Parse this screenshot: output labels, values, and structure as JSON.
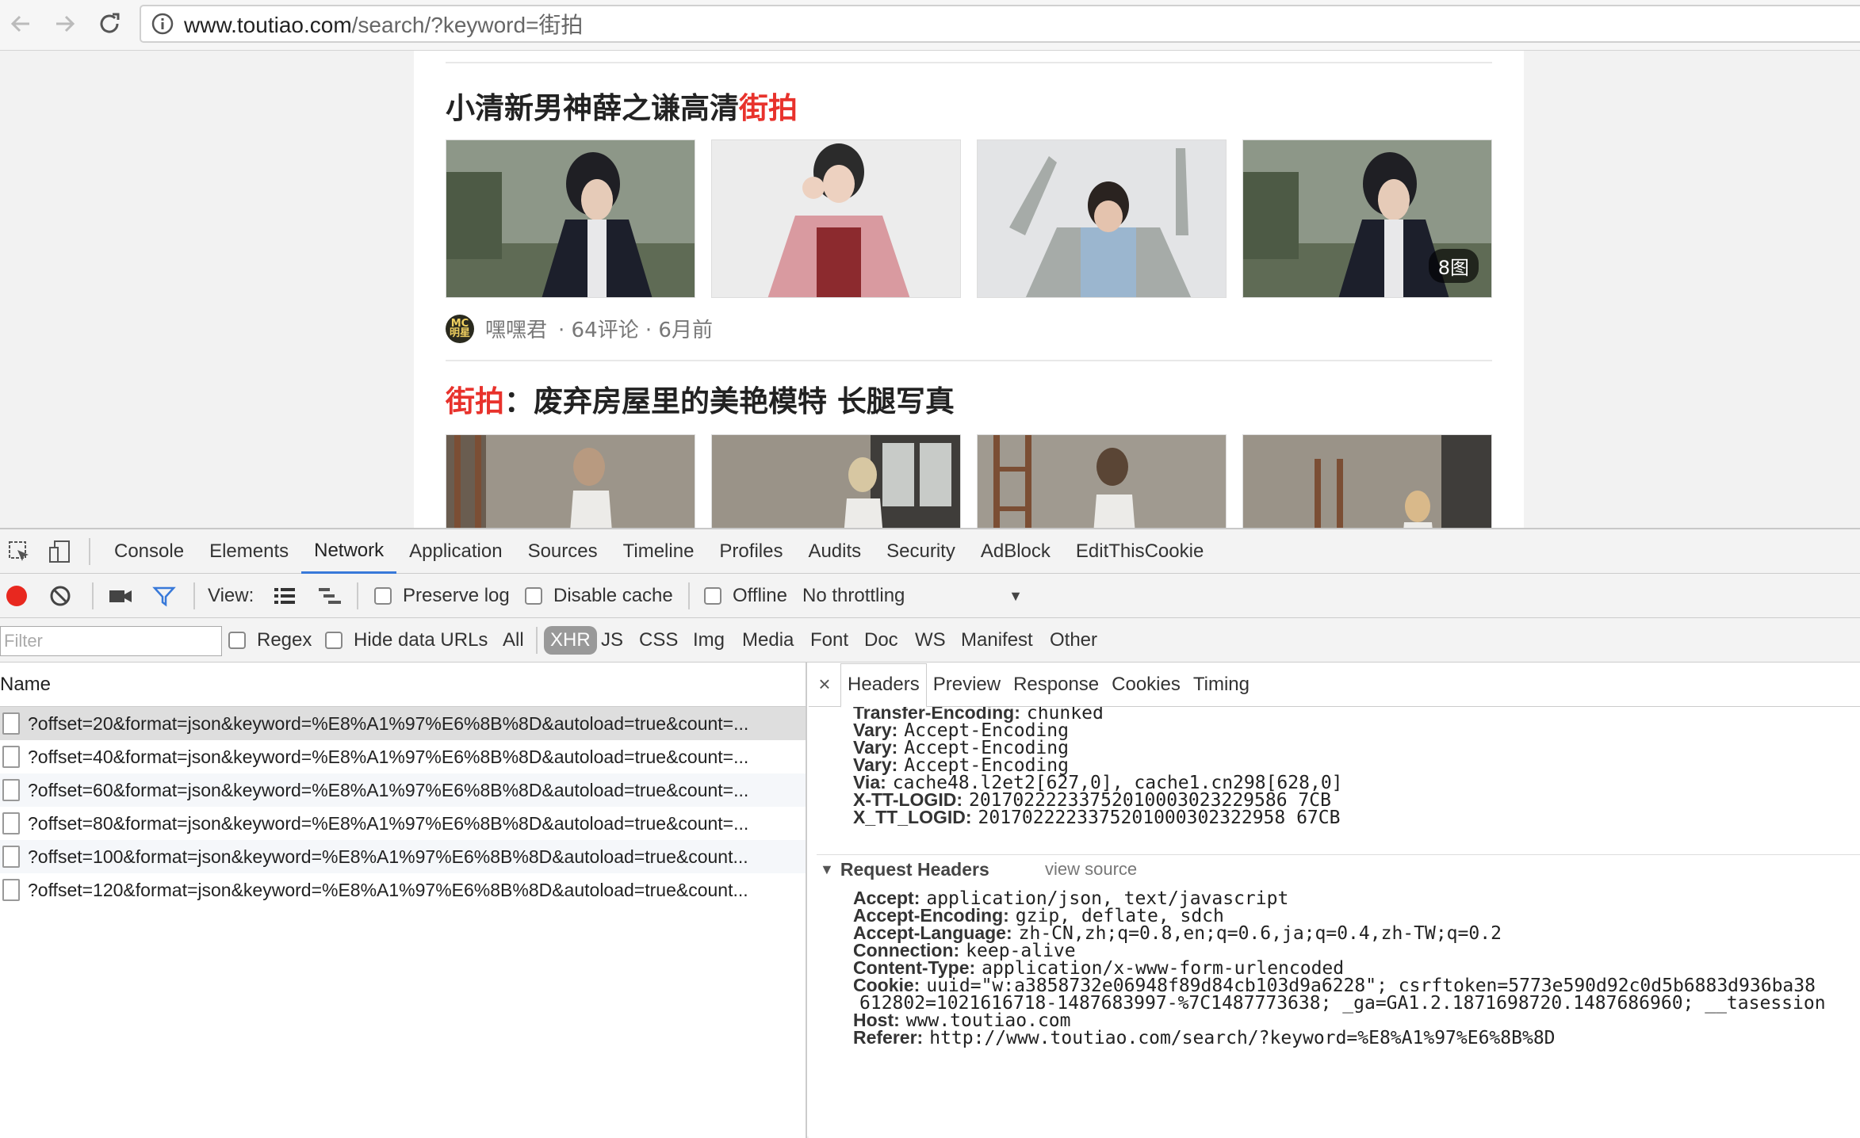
{
  "browser": {
    "url_host": "www.toutiao.com",
    "url_path": "/search/?keyword=街拍"
  },
  "page": {
    "article1": {
      "title_main": "小清新男神薛之谦高清",
      "title_highlight": "街拍",
      "image_count": "8图",
      "author": "嘿嘿君",
      "meta": "· 64评论 · 6月前",
      "avatar_text": "MC 明星"
    },
    "article2": {
      "title_highlight": "街拍",
      "title_main": "：废弃房屋里的美艳模特 长腿写真"
    }
  },
  "devtools": {
    "tabs": [
      "Console",
      "Elements",
      "Network",
      "Application",
      "Sources",
      "Timeline",
      "Profiles",
      "Audits",
      "Security",
      "AdBlock",
      "EditThisCookie"
    ],
    "active_tab": "Network",
    "toolbar": {
      "view_label": "View:",
      "preserve_log": "Preserve log",
      "disable_cache": "Disable cache",
      "offline": "Offline",
      "throttling": "No throttling"
    },
    "filter": {
      "placeholder": "Filter",
      "regex": "Regex",
      "hide_data_urls": "Hide data URLs",
      "types": [
        "All",
        "XHR",
        "JS",
        "CSS",
        "Img",
        "Media",
        "Font",
        "Doc",
        "WS",
        "Manifest",
        "Other"
      ],
      "active_type": "XHR"
    },
    "requests": {
      "column_name": "Name",
      "rows": [
        "?offset=20&format=json&keyword=%E8%A1%97%E6%8B%8D&autoload=true&count=...",
        "?offset=40&format=json&keyword=%E8%A1%97%E6%8B%8D&autoload=true&count=...",
        "?offset=60&format=json&keyword=%E8%A1%97%E6%8B%8D&autoload=true&count=...",
        "?offset=80&format=json&keyword=%E8%A1%97%E6%8B%8D&autoload=true&count=...",
        "?offset=100&format=json&keyword=%E8%A1%97%E6%8B%8D&autoload=true&count...",
        "?offset=120&format=json&keyword=%E8%A1%97%E6%8B%8D&autoload=true&count..."
      ]
    },
    "details": {
      "close": "×",
      "tabs": [
        "Headers",
        "Preview",
        "Response",
        "Cookies",
        "Timing"
      ],
      "active_tab": "Headers",
      "response_headers": [
        {
          "k": "Transfer-Encoding:",
          "v": "chunked"
        },
        {
          "k": "Vary:",
          "v": "Accept-Encoding"
        },
        {
          "k": "Vary:",
          "v": "Accept-Encoding"
        },
        {
          "k": "Vary:",
          "v": "Accept-Encoding"
        },
        {
          "k": "Via:",
          "v": "cache48.l2et2[627,0], cache1.cn298[628,0]"
        },
        {
          "k": "X-TT-LOGID:",
          "v": "20170222233752010003023229586 7CB"
        },
        {
          "k": "X_TT_LOGID:",
          "v": "2017022223375201000302322958 67CB"
        }
      ],
      "request_headers_title": "Request Headers",
      "view_source": "view source",
      "request_headers": [
        {
          "k": "Accept:",
          "v": "application/json, text/javascript"
        },
        {
          "k": "Accept-Encoding:",
          "v": "gzip, deflate, sdch"
        },
        {
          "k": "Accept-Language:",
          "v": "zh-CN,zh;q=0.8,en;q=0.6,ja;q=0.4,zh-TW;q=0.2"
        },
        {
          "k": "Connection:",
          "v": "keep-alive"
        },
        {
          "k": "Content-Type:",
          "v": "application/x-www-form-urlencoded"
        },
        {
          "k": "Cookie:",
          "v": "uuid=\"w:a3858732e06948f89d84cb103d9a6228\"; csrftoken=5773e590d92c0d5b6883d936ba38"
        },
        {
          "k": "",
          "v": "612802=1021616718-1487683997-%7C1487773638; _ga=GA1.2.1871698720.1487686960; __tasession"
        },
        {
          "k": "Host:",
          "v": "www.toutiao.com"
        },
        {
          "k": "Referer:",
          "v": "http://www.toutiao.com/search/?keyword=%E8%A1%97%E6%8B%8D"
        }
      ]
    }
  },
  "colors": {
    "highlight": "#e8322c",
    "record": "#e8281f",
    "active_tab_underline": "#3879d9"
  }
}
